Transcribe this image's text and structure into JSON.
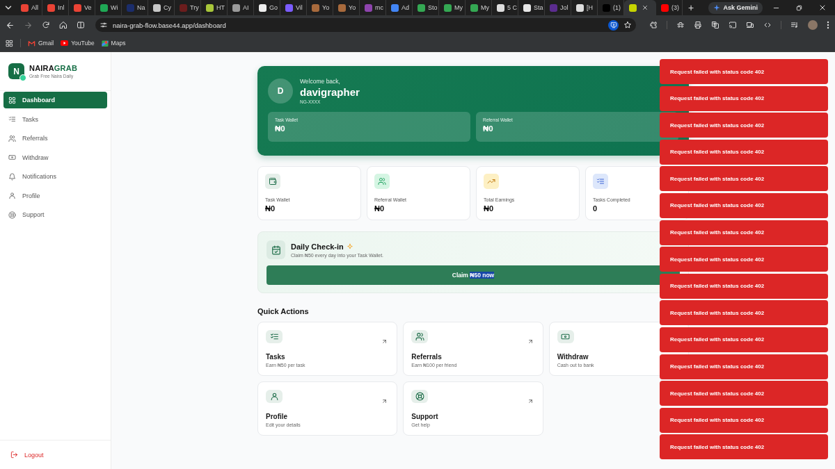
{
  "browser": {
    "tabs": [
      {
        "label": "All",
        "color": "#ea4335",
        "selected": false
      },
      {
        "label": "Inl",
        "color": "#ea4335",
        "selected": false
      },
      {
        "label": "Ve",
        "color": "#ea4335",
        "selected": false
      },
      {
        "label": "Wi",
        "color": "#1fa855",
        "selected": false
      },
      {
        "label": "Na",
        "color": "#1b2d6b",
        "selected": false
      },
      {
        "label": "Cy",
        "color": "#c8c8c8",
        "selected": false
      },
      {
        "label": "Try",
        "color": "#6b1d1d",
        "selected": false
      },
      {
        "label": "HT",
        "color": "#a8c63a",
        "selected": false
      },
      {
        "label": "AI",
        "color": "#9a9a9a",
        "selected": false
      },
      {
        "label": "Go",
        "color": "#eeeeee",
        "selected": false
      },
      {
        "label": "Vil",
        "color": "#7b5cff",
        "selected": false
      },
      {
        "label": "Yo",
        "color": "#a86a3c",
        "selected": false
      },
      {
        "label": "Yo",
        "color": "#a86a3c",
        "selected": false
      },
      {
        "label": "mc",
        "color": "#8e44ad",
        "selected": false
      },
      {
        "label": "Ad",
        "color": "#4285f4",
        "selected": false
      },
      {
        "label": "Sto",
        "color": "#34a853",
        "selected": false
      },
      {
        "label": "My",
        "color": "#34a853",
        "selected": false
      },
      {
        "label": "My",
        "color": "#34a853",
        "selected": false
      },
      {
        "label": "5 C",
        "color": "#dddddd",
        "selected": false
      },
      {
        "label": "Sta",
        "color": "#e8e8e8",
        "selected": false
      },
      {
        "label": "Jol",
        "color": "#5b2c8f",
        "selected": false
      },
      {
        "label": "[H",
        "color": "#dddddd",
        "selected": false
      },
      {
        "label": "(1)",
        "color": "#000000",
        "selected": false
      },
      {
        "color": "#c6d400",
        "selected": true
      },
      {
        "label": "(3)",
        "color": "#ff0000",
        "selected": false
      }
    ],
    "new_tab": "+",
    "gemini_button": "Ask Gemini",
    "forward_disabled": true,
    "url": "naira-grab-flow.base44.app/dashboard",
    "bookmarks": [
      {
        "label": "Gmail",
        "kind": "mail"
      },
      {
        "label": "YouTube",
        "kind": "video"
      },
      {
        "label": "Maps",
        "kind": "map"
      }
    ]
  },
  "sidebar": {
    "logo_letter": "N",
    "brand_main": "NAIRA",
    "brand_accent": "GRAB",
    "tagline": "Grab Free Naira Daily",
    "items": [
      {
        "label": "Dashboard",
        "kind": "dashboard",
        "selected": true
      },
      {
        "label": "Tasks",
        "kind": "tasks",
        "selected": false
      },
      {
        "label": "Referrals",
        "kind": "referrals",
        "selected": false
      },
      {
        "label": "Withdraw",
        "kind": "withdraw",
        "selected": false
      },
      {
        "label": "Notifications",
        "kind": "notifications",
        "selected": false
      },
      {
        "label": "Profile",
        "kind": "profile",
        "selected": false
      },
      {
        "label": "Support",
        "kind": "support",
        "selected": false
      }
    ],
    "logout": "Logout"
  },
  "welcome": {
    "avatar_letter": "D",
    "greeting": "Welcome back,",
    "username": "davigrapher",
    "user_id": "NG-XXXX",
    "wallets": [
      {
        "label": "Task Wallet",
        "amount": "₦0"
      },
      {
        "label": "Referral Wallet",
        "amount": "₦0"
      }
    ]
  },
  "stats": [
    {
      "kind": "wallet",
      "label": "Task Wallet",
      "value": "₦0"
    },
    {
      "kind": "referrals",
      "label": "Referral Wallet",
      "value": "₦0"
    },
    {
      "kind": "earnings",
      "label": "Total Earnings",
      "value": "₦0"
    },
    {
      "kind": "tasks",
      "label": "Tasks Completed",
      "value": "0"
    }
  ],
  "checkin": {
    "title": "Daily Check-in",
    "subtitle": "Claim ₦50 every day into your Task Wallet.",
    "button_label": "Claim",
    "button_selected_text": "₦50 now"
  },
  "quick_actions": {
    "heading": "Quick Actions",
    "items": [
      {
        "kind": "tasks",
        "title": "Tasks",
        "subtitle": "Earn ₦50 per task",
        "arrow": true
      },
      {
        "kind": "referrals",
        "title": "Referrals",
        "subtitle": "Earn ₦100 per friend",
        "arrow": true
      },
      {
        "kind": "withdraw",
        "title": "Withdraw",
        "subtitle": "Cash out to bank",
        "arrow": false
      },
      {
        "kind": "profile",
        "title": "Profile",
        "subtitle": "Edit your details",
        "arrow": true
      },
      {
        "kind": "support",
        "title": "Support",
        "subtitle": "Get help",
        "arrow": true
      }
    ]
  },
  "toasts": [
    {
      "message": "Request failed with status code 402"
    },
    {
      "message": "Request failed with status code 402"
    },
    {
      "message": "Request failed with status code 402"
    },
    {
      "message": "Request failed with status code 402"
    },
    {
      "message": "Request failed with status code 402"
    },
    {
      "message": "Request failed with status code 402"
    },
    {
      "message": "Request failed with status code 402"
    },
    {
      "message": "Request failed with status code 402"
    },
    {
      "message": "Request failed with status code 402"
    },
    {
      "message": "Request failed with status code 402"
    },
    {
      "message": "Request failed with status code 402"
    },
    {
      "message": "Request failed with status code 402"
    },
    {
      "message": "Request failed with status code 402"
    },
    {
      "message": "Request failed with status code 402"
    },
    {
      "message": "Request failed with status code 402"
    }
  ]
}
